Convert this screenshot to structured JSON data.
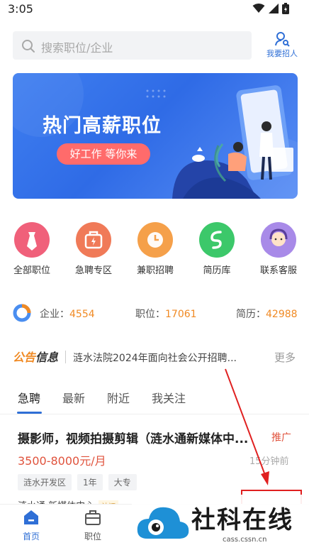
{
  "status_bar": {
    "time": "3:05"
  },
  "search": {
    "placeholder": "搜索职位/企业",
    "recruit_label": "我要招人"
  },
  "banner": {
    "title": "热门高薪职位",
    "pill": "好工作 等你来"
  },
  "quick_nav": [
    {
      "label": "全部职位",
      "icon": "tie-icon",
      "color": "#f0607a"
    },
    {
      "label": "急聘专区",
      "icon": "urgent-bag-icon",
      "color": "#f07a58"
    },
    {
      "label": "兼职招聘",
      "icon": "clock-icon",
      "color": "#f5a04a"
    },
    {
      "label": "简历库",
      "icon": "resume-icon",
      "color": "#3cc86a"
    },
    {
      "label": "联系客服",
      "icon": "service-icon",
      "color": "#a88ae8"
    }
  ],
  "stats": {
    "company_label": "企业：",
    "company_value": "4554",
    "job_label": "职位：",
    "job_value": "17061",
    "resume_label": "简历：",
    "resume_value": "42988"
  },
  "notice": {
    "badge_a": "公告",
    "badge_b": "信息",
    "text": "涟水法院2024年面向社会公开招聘...",
    "more": "更多"
  },
  "tabs": [
    "急聘",
    "最新",
    "附近",
    "我关注"
  ],
  "job": {
    "title": "摄影师，视频拍摄剪辑（涟水通新媒体中...",
    "promo": "推广",
    "salary": "3500-8000元/月",
    "time": "15分钟前",
    "tags": [
      "涟水开发区",
      "1年",
      "大专"
    ],
    "company": "涟水通 新媒体中心",
    "company_badge": "认证"
  },
  "tabbar": [
    {
      "label": "首页",
      "icon": "home-icon"
    },
    {
      "label": "职位",
      "icon": "briefcase-icon"
    }
  ],
  "watermark": {
    "text": "社科在线",
    "url": "cass.cssn.cn"
  },
  "colors": {
    "accent": "#2f6fd6",
    "orange": "#f08a24",
    "red": "#e0533d"
  }
}
